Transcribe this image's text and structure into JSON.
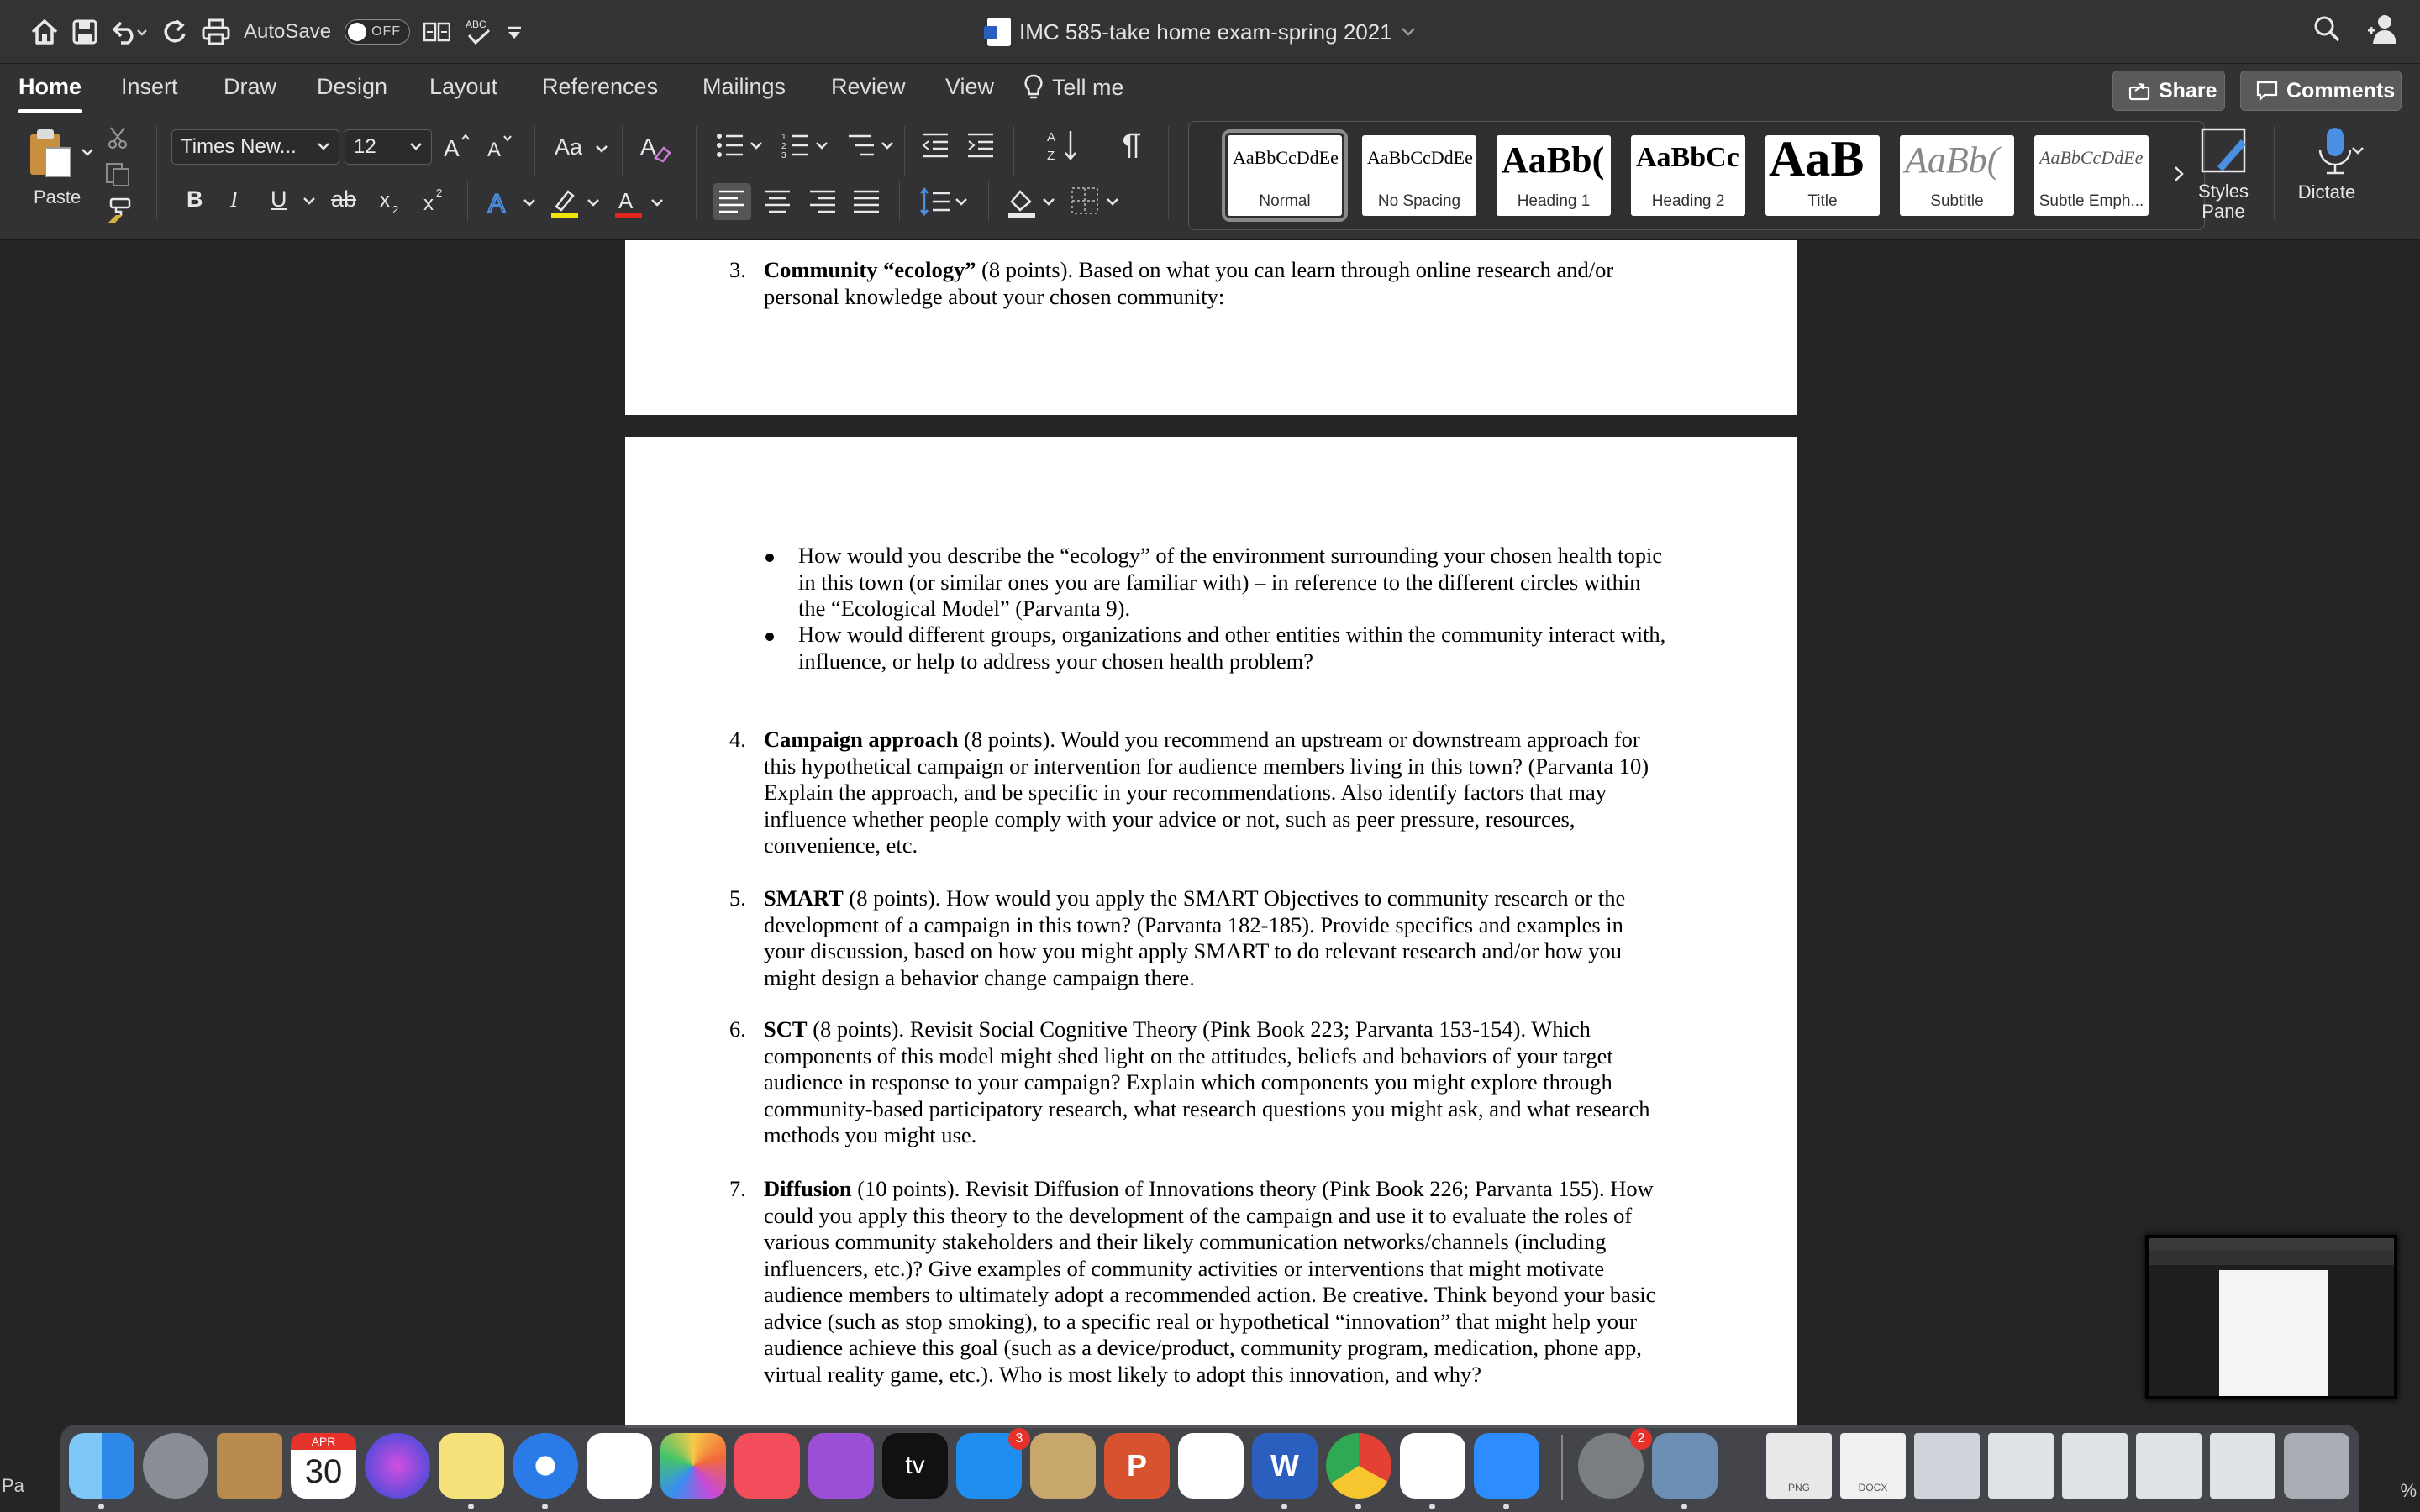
{
  "titlebar": {
    "autosave_label": "AutoSave",
    "autosave_state": "OFF",
    "doc_title": "IMC 585-take home exam-spring 2021"
  },
  "tabs": {
    "items": [
      "Home",
      "Insert",
      "Draw",
      "Design",
      "Layout",
      "References",
      "Mailings",
      "Review",
      "View"
    ],
    "tell_me": "Tell me",
    "share": "Share",
    "comments": "Comments"
  },
  "ribbon": {
    "paste": "Paste",
    "font_name": "Times New...",
    "font_size": "12",
    "change_case": "Aa",
    "bold": "B",
    "italic": "I",
    "underline": "U",
    "strike": "ab",
    "styles": [
      {
        "sample": "AaBbCcDdEe",
        "name": "Normal"
      },
      {
        "sample": "AaBbCcDdEe",
        "name": "No Spacing"
      },
      {
        "sample": "AaBb(",
        "name": "Heading 1"
      },
      {
        "sample": "AaBbCc",
        "name": "Heading 2"
      },
      {
        "sample": "AaB",
        "name": "Title"
      },
      {
        "sample": "AaBb(",
        "name": "Subtitle"
      },
      {
        "sample": "AaBbCcDdEe",
        "name": "Subtle Emph..."
      }
    ],
    "styles_pane_1": "Styles",
    "styles_pane_2": "Pane",
    "dictate": "Dictate"
  },
  "document": {
    "q3": {
      "num": "3.",
      "title": "Community “ecology”",
      "line1": " (8 points). Based on what you can learn through online research and/or",
      "line2": "personal knowledge about your chosen community:"
    },
    "bullets": [
      {
        "lines": [
          "How would you describe the “ecology” of the environment surrounding your chosen health topic",
          "in this town (or similar ones you are familiar with) – in reference to the different circles within",
          "the “Ecological Model” (Parvanta 9)."
        ]
      },
      {
        "lines": [
          "How would different groups, organizations and other entities within the community interact with,",
          "influence, or help to address your chosen health problem?"
        ]
      }
    ],
    "q4": {
      "num": "4.",
      "title": "Campaign approach",
      "lines": [
        " (8 points). Would you recommend an upstream or downstream approach for",
        "this hypothetical campaign or intervention for audience members living in this town? (Parvanta 10)",
        "Explain the approach, and be specific in your recommendations. Also identify factors that may",
        "influence whether people comply with your advice or not, such as peer pressure, resources,",
        "convenience, etc."
      ]
    },
    "q5": {
      "num": "5.",
      "title": "SMART",
      "lines": [
        " (8 points). How would you apply the SMART Objectives to community research or the",
        "development of a campaign in this town? (Parvanta 182-185). Provide specifics and examples in",
        "your discussion, based on how you might apply SMART to do relevant research and/or how you",
        "might design a behavior change campaign there."
      ]
    },
    "q6": {
      "num": "6.",
      "title": "SCT",
      "lines": [
        " (8 points). Revisit Social Cognitive Theory (Pink Book 223; Parvanta 153-154). Which",
        "components of this model might shed light on the attitudes, beliefs and behaviors of your target",
        "audience in response to your campaign? Explain which components you might explore through",
        "community-based participatory research, what research questions you might ask, and what research",
        "methods you might use."
      ]
    },
    "q7": {
      "num": "7.",
      "title": "Diffusion",
      "lines": [
        " (10 points). Revisit Diffusion of Innovations theory (Pink Book 226; Parvanta 155). How",
        "could you apply this theory to the development of the campaign and use it to evaluate the roles of",
        "various community stakeholders and their likely communication networks/channels (including",
        "influencers, etc.)? Give examples of community activities or interventions that might motivate",
        "audience members to ultimately adopt a recommended action. Be creative. Think beyond your basic",
        "advice (such as stop smoking), to a specific real or hypothetical “innovation” that might help your",
        "audience achieve this goal (such as a device/product, community program, medication, phone app,",
        "virtual reality game, etc.). Who is most likely to adopt this innovation, and why?"
      ]
    }
  },
  "dock": {
    "calendar_month": "APR",
    "calendar_day": "30",
    "appstore_badge": "3",
    "settings_badge": "2",
    "tv_label": "tv",
    "file_png": "PNG",
    "file_docx": "DOCX"
  },
  "status": {
    "left": "Pa",
    "right": "%"
  }
}
